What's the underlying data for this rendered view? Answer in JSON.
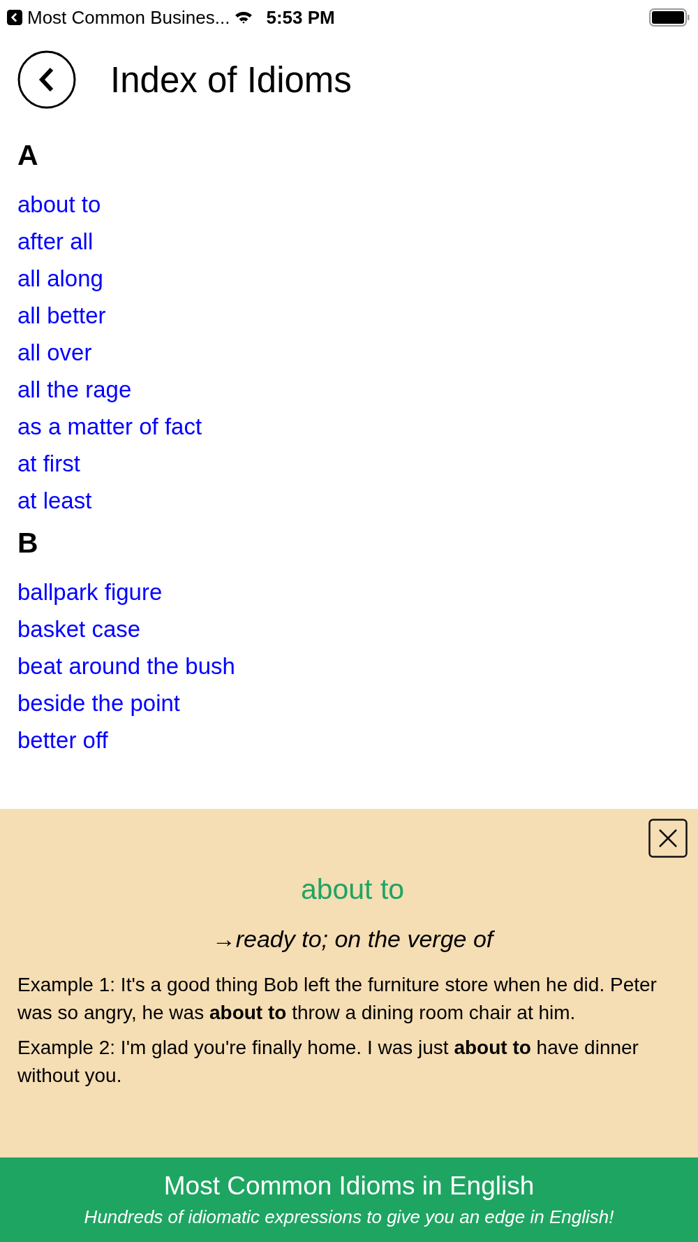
{
  "status_bar": {
    "back_app": "Most Common Busines...",
    "time": "5:53 PM"
  },
  "header": {
    "title": "Index of Idioms"
  },
  "sections": [
    {
      "letter": "A",
      "items": [
        "about to",
        "after all",
        "all along",
        "all better",
        "all over",
        "all the rage",
        "as a matter of fact",
        "at first",
        "at least"
      ]
    },
    {
      "letter": "B",
      "items": [
        "ballpark figure",
        "basket case",
        "beat around the bush",
        "beside the point",
        "better off"
      ]
    }
  ],
  "popup": {
    "idiom": "about to",
    "definition": "→*ready to; on the verge of*",
    "examples": [
      "Example 1: It's a good thing Bob left the furniture store when he did. Peter was so angry, he was **about to** throw a dining room chair at him.",
      "Example 2: I'm glad you're finally home. I was just **about to** have dinner without you."
    ]
  },
  "footer": {
    "title": "Most Common Idioms in English",
    "subtitle": "Hundreds of idiomatic expressions to give you an edge in English!"
  }
}
